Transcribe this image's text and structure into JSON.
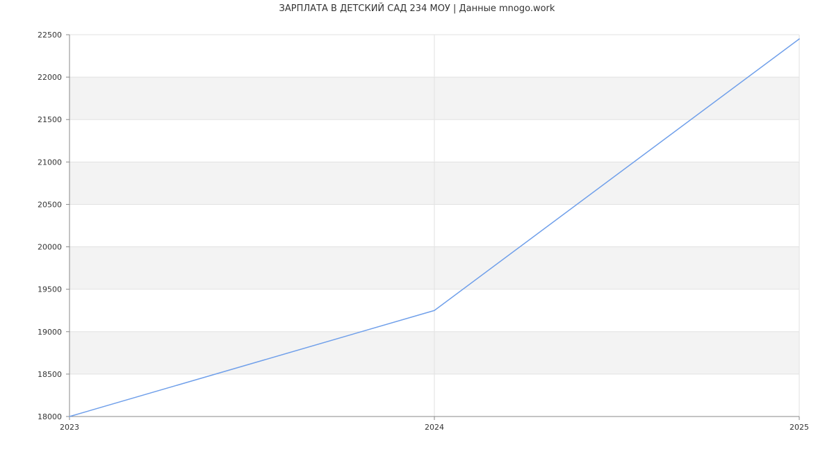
{
  "chart_data": {
    "type": "line",
    "title": "ЗАРПЛАТА В ДЕТСКИЙ САД 234 МОУ | Данные mnogo.work",
    "xlabel": "",
    "ylabel": "",
    "x": [
      "2023",
      "2024",
      "2025"
    ],
    "series": [
      {
        "values": [
          18000,
          19250,
          22450
        ]
      }
    ],
    "xlim": [
      2023,
      2025
    ],
    "ylim": [
      18000,
      22500
    ],
    "y_ticks": [
      18000,
      18500,
      19000,
      19500,
      20000,
      20500,
      21000,
      21500,
      22000,
      22500
    ],
    "grid": true,
    "legend": "none",
    "colors": {
      "line": "#6f9fea",
      "band": "#f3f3f3",
      "grid": "#e2e2e2",
      "axis": "#888888"
    }
  }
}
